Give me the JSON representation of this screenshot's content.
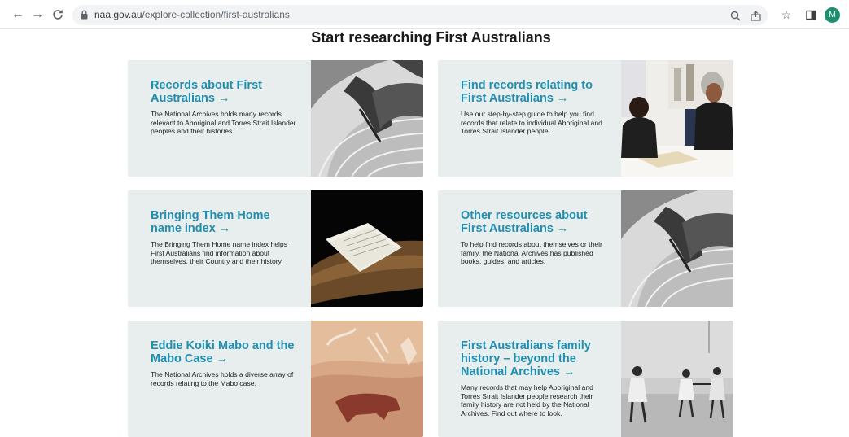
{
  "browser": {
    "url_host": "naa.gov.au",
    "url_path": "/explore-collection/first-australians",
    "avatar_letter": "M"
  },
  "page": {
    "title": "Start researching First Australians"
  },
  "cards": [
    {
      "title": "Records about First Australians →",
      "text": "The National Archives holds many records relevant to Aboriginal and Torres Strait Islander peoples and their histories.",
      "image": "hand-painting-photo"
    },
    {
      "title": "Find records relating to First Australians →",
      "text": "Use our step-by-step guide to help you find records that relate to individual Aboriginal and Torres Strait Islander people.",
      "image": "two-women-reviewing-records-photo"
    },
    {
      "title": "Bringing Them Home name index →",
      "text": "The Bringing Them Home name index helps First Australians find information about themselves, their Country and their history.",
      "image": "document-on-wooden-dish-photo"
    },
    {
      "title": "Other resources about First Australians →",
      "text": "To help find records about themselves or their family, the National Archives has published books, guides, and articles.",
      "image": "hand-painting-photo"
    },
    {
      "title": "Eddie Koiki Mabo and the Mabo Case →",
      "text": "The National Archives holds a diverse array of records relating to the Mabo case.",
      "image": "rock-art-photo"
    },
    {
      "title": "First Australians family history – beyond the National Archives →",
      "text": "Many records that may help Aboriginal and Torres Strait Islander people research their family history are not held by the National Archives. Find out where to look.",
      "image": "children-walking-photo"
    }
  ]
}
